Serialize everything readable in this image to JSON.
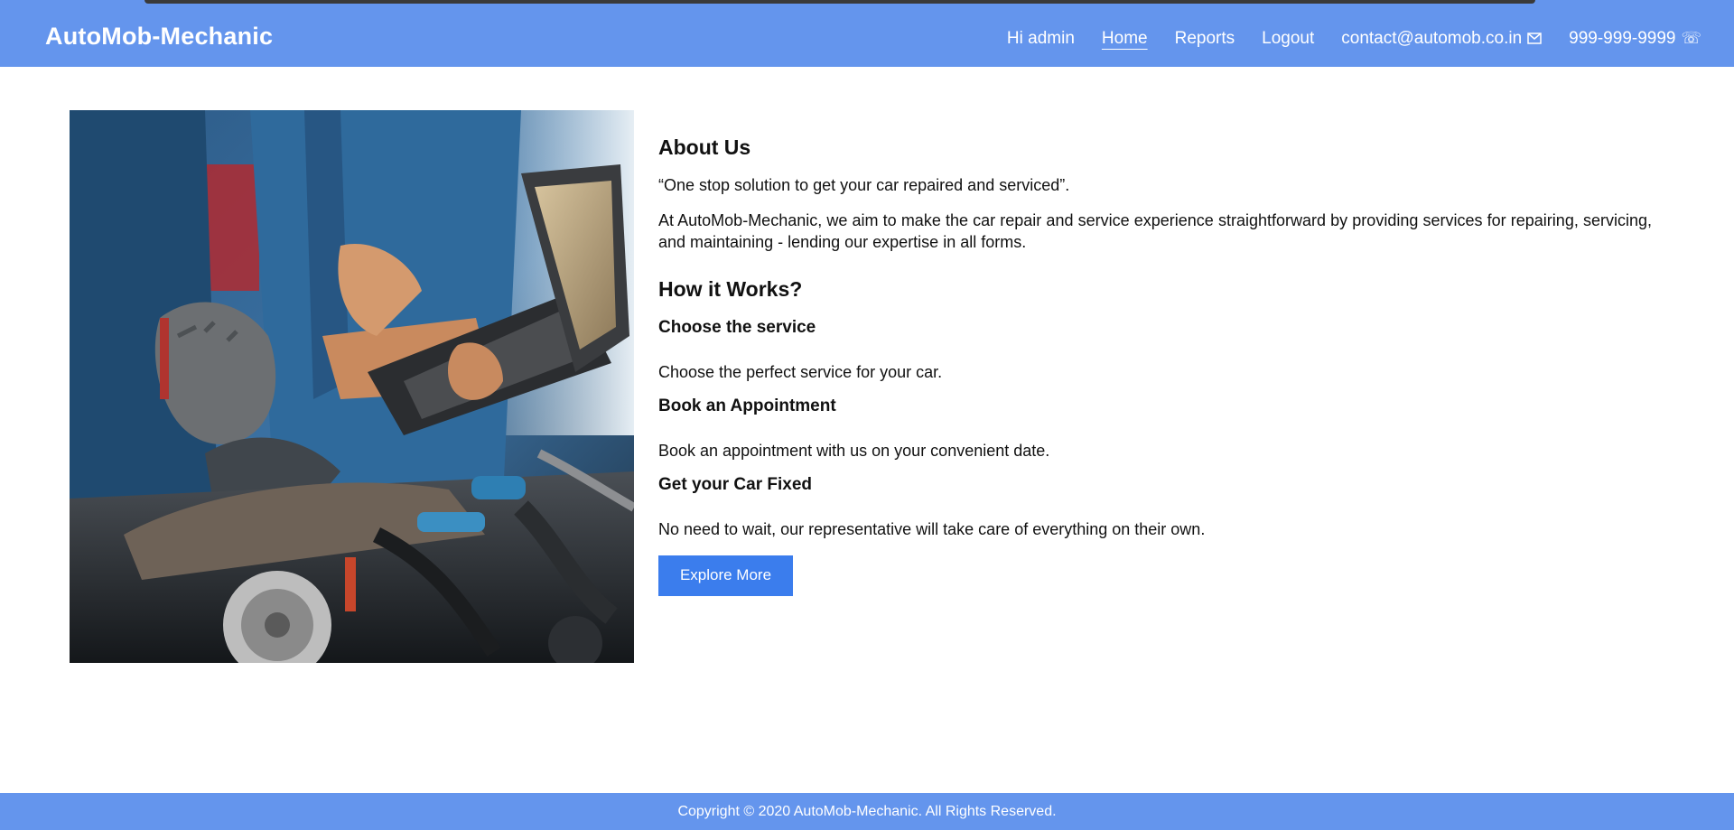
{
  "navbar": {
    "brand": "AutoMob-Mechanic",
    "greeting": "Hi admin",
    "links": [
      "Home",
      "Reports",
      "Logout"
    ],
    "active_link": "Home",
    "email": "contact@automob.co.in",
    "phone": "999-999-9999",
    "email_icon": "mail-icon",
    "phone_icon": "phone-icon"
  },
  "hero": {
    "image_subject": "mechanics-with-laptop-engine-photo"
  },
  "about": {
    "title": "About Us",
    "tagline": "“One stop solution to get your car repaired and serviced”.",
    "description": "At AutoMob-Mechanic, we aim to make the car repair and service experience straightforward by providing services for repairing, servicing, and maintaining - lending our expertise in all forms."
  },
  "how_it_works": {
    "title": "How it Works?",
    "steps": [
      {
        "title": "Choose the service",
        "text": "Choose the perfect service for your car."
      },
      {
        "title": "Book an Appointment",
        "text": "Book an appointment with us on your convenient date."
      },
      {
        "title": "Get your Car Fixed",
        "text": "No need to wait, our representative will take care of everything on their own."
      }
    ],
    "button_label": "Explore More"
  },
  "footer": {
    "copyright": "Copyright © 2020 AutoMob-Mechanic.  All Rights Reserved."
  },
  "colors": {
    "navbar_bg": "#6495ed",
    "button_bg": "#3b7ded",
    "text": "#111111"
  }
}
